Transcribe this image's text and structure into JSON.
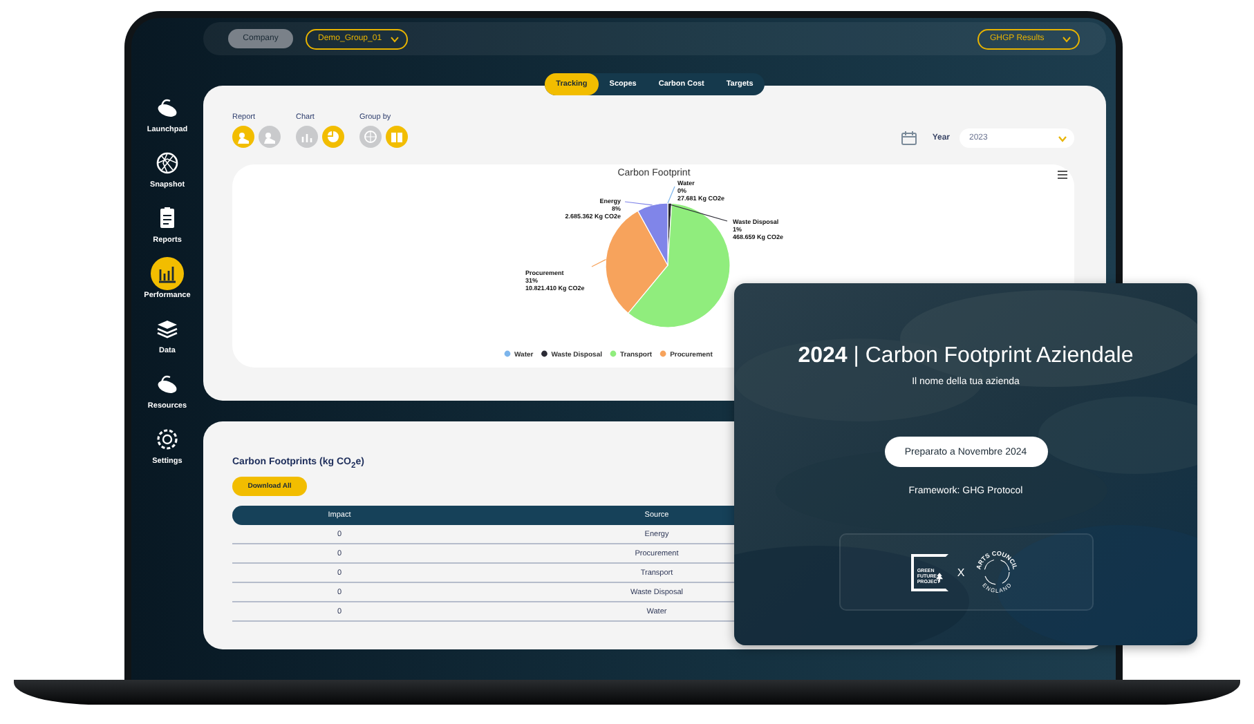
{
  "top_bar": {
    "company_button": "Company",
    "group_select": "Demo_Group_01",
    "results_select": "GHGP Results"
  },
  "sidebar": {
    "items": [
      {
        "label": "Launchpad",
        "selected": false
      },
      {
        "label": "Snapshot",
        "selected": false
      },
      {
        "label": "Reports",
        "selected": false
      },
      {
        "label": "Performance",
        "selected": true
      },
      {
        "label": "Data",
        "selected": false
      },
      {
        "label": "Resources",
        "selected": false
      },
      {
        "label": "Settings",
        "selected": false
      }
    ]
  },
  "tabs": [
    {
      "label": "Tracking",
      "selected": true
    },
    {
      "label": "Scopes",
      "selected": false
    },
    {
      "label": "Carbon Cost",
      "selected": false
    },
    {
      "label": "Targets",
      "selected": false
    }
  ],
  "filters": {
    "groups": [
      {
        "label": "Report",
        "options": [
          {
            "selected": true
          },
          {
            "selected": false
          }
        ]
      },
      {
        "label": "Chart",
        "options": [
          {
            "selected": false
          },
          {
            "selected": true
          }
        ]
      },
      {
        "label": "Group by",
        "options": [
          {
            "selected": false
          },
          {
            "selected": true
          }
        ]
      }
    ],
    "year_label": "Year",
    "year": "2023"
  },
  "chart": {
    "chart_data": {
      "type": "pie",
      "title": "Carbon Footprint",
      "categories": [
        "Water",
        "Waste Disposal",
        "Transport",
        "Procurement",
        "Energy"
      ],
      "colors": [
        "#7cb5ec",
        "#2b2b35",
        "#90ed7d",
        "#f7a35c",
        "#8085e9"
      ],
      "values": [
        0,
        1,
        60,
        31,
        8
      ],
      "value_labels": [
        "0%",
        "1%",
        null,
        "31%",
        "8%"
      ],
      "annotations": [
        {
          "text": "27.681 Kg CO2e"
        },
        {
          "text": "468.659 Kg CO2e"
        },
        null,
        {
          "text": "10.821.410 Kg CO2e"
        },
        {
          "text": "2.685.362 Kg CO2e"
        }
      ],
      "legend": "bottom"
    }
  },
  "table_card": {
    "title": "Carbon Footprints (kg CO$_{2}$e)",
    "download_button": "Download All",
    "columns": [
      "Impact",
      "Source"
    ],
    "rows": [
      [
        "0",
        "Energy"
      ],
      [
        "0",
        "Procurement"
      ],
      [
        "0",
        "Transport"
      ],
      [
        "0",
        "Waste Disposal"
      ],
      [
        "0",
        "Water"
      ]
    ]
  },
  "cover": {
    "title": "**2024** | Carbon Footprint Aziendale",
    "subtitle": "Il nome della tua azienda",
    "date_pill": "Preparato a Novembre 2024",
    "framework": "Framework: GHG Protocol",
    "logo_text": "GREEN FUTURE PROJECT",
    "separator": "X",
    "partner_top": "ARTS COUNCIL",
    "partner_bottom": "ENGLAND"
  }
}
